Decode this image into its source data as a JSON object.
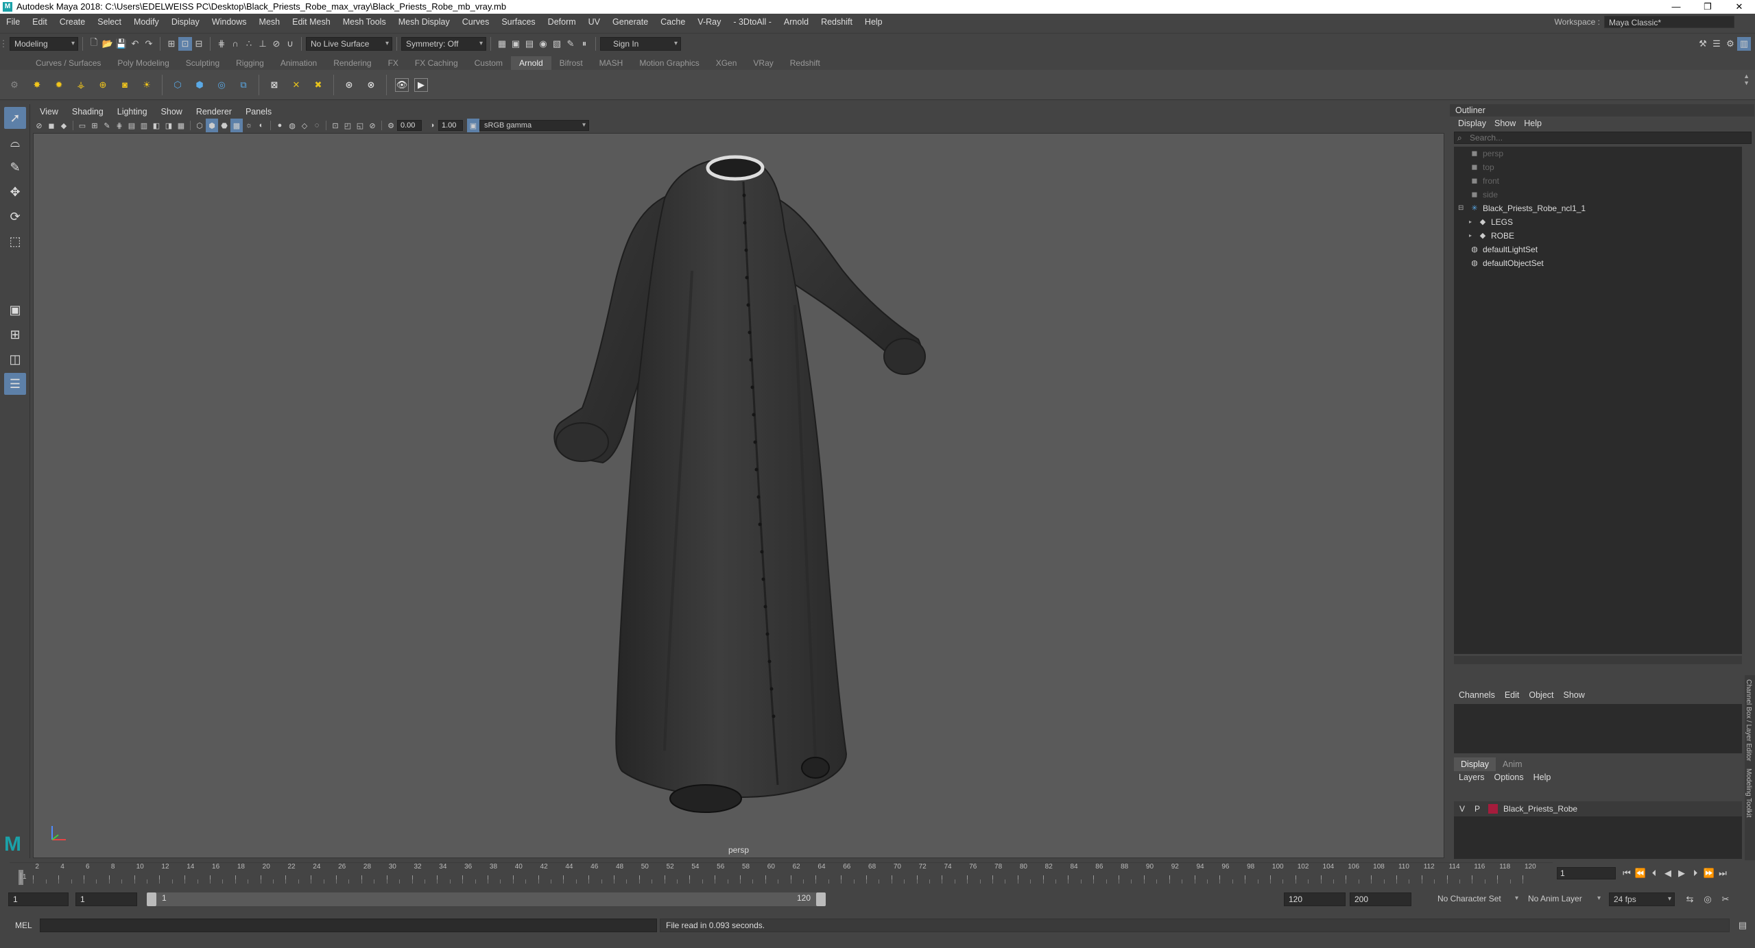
{
  "window": {
    "title": "Autodesk Maya 2018: C:\\Users\\EDELWEISS PC\\Desktop\\Black_Priests_Robe_max_vray\\Black_Priests_Robe_mb_vray.mb",
    "app_icon": "M",
    "controls": [
      "—",
      "❐",
      "✕"
    ]
  },
  "menubar": {
    "items": [
      "File",
      "Edit",
      "Create",
      "Select",
      "Modify",
      "Display",
      "Windows",
      "Mesh",
      "Edit Mesh",
      "Mesh Tools",
      "Mesh Display",
      "Curves",
      "Surfaces",
      "Deform",
      "UV",
      "Generate",
      "Cache",
      "V-Ray",
      "- 3DtoAll -",
      "Arnold",
      "Redshift",
      "Help"
    ],
    "workspace_label": "Workspace :",
    "workspace_value": "Maya Classic*"
  },
  "statusline": {
    "mode": "Modeling",
    "live_surface": "No Live Surface",
    "symmetry": "Symmetry: Off",
    "sign_in": "Sign In"
  },
  "shelf": {
    "tabs": [
      "Curves / Surfaces",
      "Poly Modeling",
      "Sculpting",
      "Rigging",
      "Animation",
      "Rendering",
      "FX",
      "FX Caching",
      "Custom",
      "Arnold",
      "Bifrost",
      "MASH",
      "Motion Graphics",
      "XGen",
      "VRay",
      "Redshift"
    ],
    "active_tab": "Arnold"
  },
  "viewport": {
    "menu": [
      "View",
      "Shading",
      "Lighting",
      "Show",
      "Renderer",
      "Panels"
    ],
    "exposure": "0.00",
    "gamma": "1.00",
    "color_space": "sRGB gamma",
    "camera": "persp"
  },
  "outliner": {
    "title": "Outliner",
    "menu": [
      "Display",
      "Show",
      "Help"
    ],
    "search_placeholder": "Search...",
    "nodes": [
      {
        "label": "persp",
        "icon": "camera-icon",
        "dim": true
      },
      {
        "label": "top",
        "icon": "camera-icon",
        "dim": true
      },
      {
        "label": "front",
        "icon": "camera-icon",
        "dim": true
      },
      {
        "label": "side",
        "icon": "camera-icon",
        "dim": true
      },
      {
        "label": "Black_Priests_Robe_ncl1_1",
        "icon": "group-icon",
        "dim": false
      },
      {
        "label": "LEGS",
        "icon": "mesh-icon",
        "dim": false
      },
      {
        "label": "ROBE",
        "icon": "mesh-icon",
        "dim": false
      },
      {
        "label": "defaultLightSet",
        "icon": "set-icon",
        "dim": false
      },
      {
        "label": "defaultObjectSet",
        "icon": "set-icon",
        "dim": false
      }
    ]
  },
  "channelbox": {
    "menu": [
      "Channels",
      "Edit",
      "Object",
      "Show"
    ]
  },
  "layereditor": {
    "tabs": [
      "Display",
      "Anim"
    ],
    "menu": [
      "Layers",
      "Options",
      "Help"
    ],
    "layer": {
      "v": "V",
      "p": "P",
      "name": "Black_Priests_Robe",
      "color": "#a51c3c"
    }
  },
  "sidetabs": {
    "channel": "Channel Box / Layer Editor",
    "modeling": "Modeling Toolkit"
  },
  "timeslider": {
    "ticks": [
      "1",
      "2",
      "4",
      "6",
      "8",
      "10",
      "12",
      "14",
      "16",
      "18",
      "20",
      "22",
      "24",
      "26",
      "28",
      "30",
      "32",
      "34",
      "36",
      "38",
      "40",
      "42",
      "44",
      "46",
      "48",
      "50",
      "52",
      "54",
      "56",
      "58",
      "60",
      "62",
      "64",
      "66",
      "68",
      "70",
      "72",
      "74",
      "76",
      "78",
      "80",
      "82",
      "84",
      "86",
      "88",
      "90",
      "92",
      "94",
      "96",
      "98",
      "100",
      "102",
      "104",
      "106",
      "108",
      "110",
      "112",
      "114",
      "116",
      "118",
      "120"
    ],
    "current_frame": "1"
  },
  "range": {
    "start": "1",
    "anim_start": "1",
    "slider_start": "1",
    "slider_end": "120",
    "anim_end": "120",
    "end": "200",
    "character_set": "No Character Set",
    "anim_layer": "No Anim Layer",
    "fps": "24 fps"
  },
  "command": {
    "lang": "MEL",
    "result": "File read in  0.093 seconds."
  }
}
